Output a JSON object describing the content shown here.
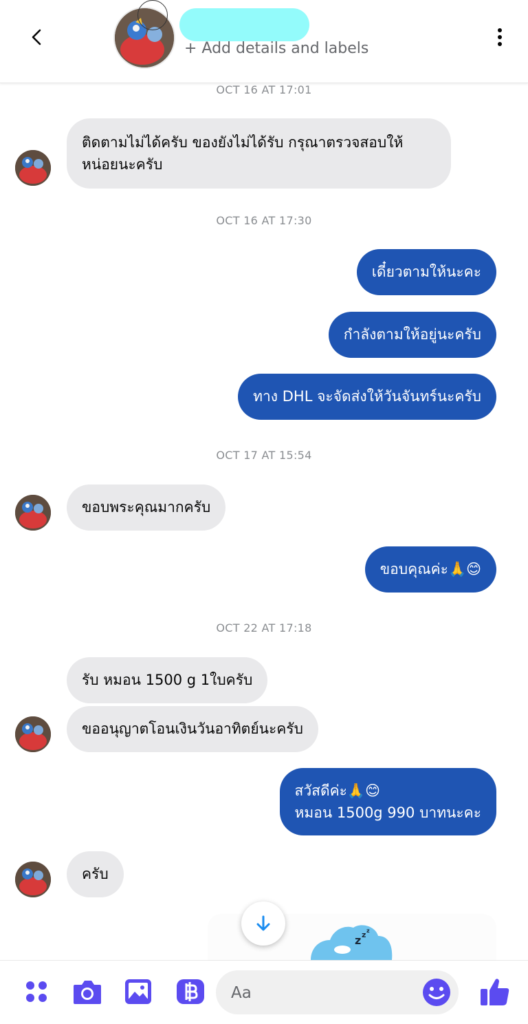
{
  "header": {
    "add_details": "+ Add details and labels"
  },
  "timestamps": [
    "OCT 16 AT 17:01",
    "OCT 16 AT 17:30",
    "OCT 17 AT 15:54",
    "OCT 22 AT 17:18"
  ],
  "messages": [
    {
      "dir": "in",
      "text": "ติดตามไม่ได้ครับ ของยังไม่ได้รับ กรุณาตรวจสอบให้\nหน่อยนะครับ"
    },
    {
      "dir": "out",
      "text": "เดี๋ยวตามให้นะคะ"
    },
    {
      "dir": "out",
      "text": "กำลังตามให้อยู่นะครับ"
    },
    {
      "dir": "out",
      "text": "ทาง DHL จะจัดส่งให้วันจันทร์นะครับ"
    },
    {
      "dir": "in",
      "text": "ขอบพระคุณมากครับ"
    },
    {
      "dir": "out",
      "text": "ขอบคุณค่ะ🙏😊"
    },
    {
      "dir": "in",
      "text": "รับ หมอน 1500 g   1ใบครับ"
    },
    {
      "dir": "in",
      "text": "ขออนุญาตโอนเงินวันอาทิตย์นะครับ"
    },
    {
      "dir": "out",
      "text": "สวัสดีค่ะ🙏😊\nหมอน 1500g 990 บาทนะคะ"
    },
    {
      "dir": "in",
      "text": "ครับ"
    }
  ],
  "composer": {
    "placeholder": "Aa"
  },
  "colors": {
    "outgoing_bubble": "#1f55b3",
    "incoming_bubble": "#e9e9eb",
    "accent": "#5b4bf0",
    "name_redaction": "#93fbfb"
  },
  "icons": [
    "back-arrow-icon",
    "more-vertical-icon",
    "apps-icon",
    "camera-icon",
    "gallery-icon",
    "crypto-baht-icon",
    "emoji-icon",
    "like-thumb-icon",
    "arrow-down-icon"
  ]
}
